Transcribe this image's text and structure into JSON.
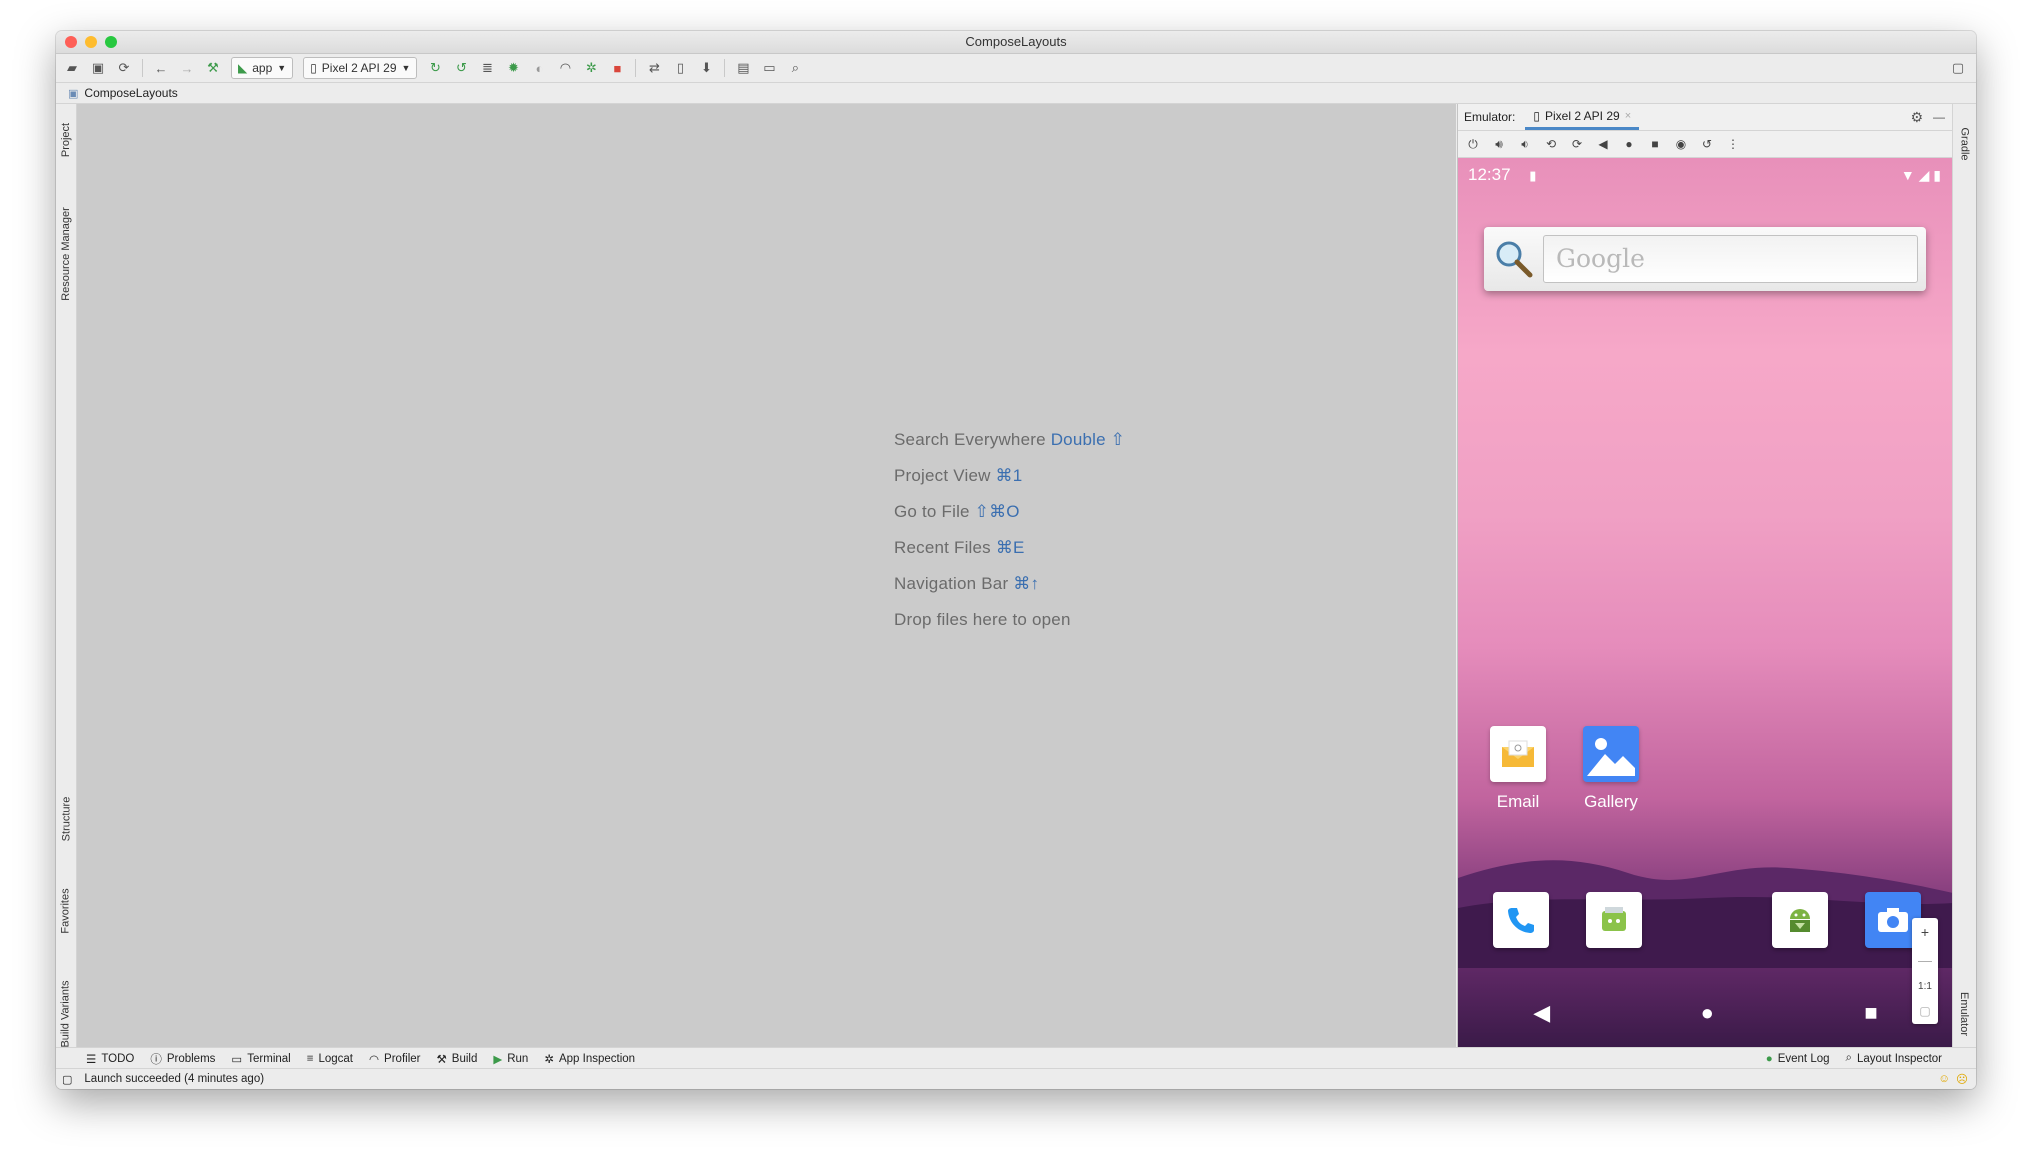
{
  "window": {
    "title": "ComposeLayouts"
  },
  "toolbar": {
    "run_config": "app",
    "device": "Pixel 2 API 29"
  },
  "breadcrumb": {
    "project": "ComposeLayouts"
  },
  "left_tabs": {
    "project": "Project",
    "resource_manager": "Resource Manager",
    "structure": "Structure",
    "favorites": "Favorites",
    "build_variants": "Build Variants"
  },
  "editor_hints": [
    {
      "label": "Search Everywhere",
      "shortcut": "Double ⇧"
    },
    {
      "label": "Project View",
      "shortcut": "⌘1"
    },
    {
      "label": "Go to File",
      "shortcut": "⇧⌘O"
    },
    {
      "label": "Recent Files",
      "shortcut": "⌘E"
    },
    {
      "label": "Navigation Bar",
      "shortcut": "⌘↑"
    },
    {
      "label": "Drop files here to open",
      "shortcut": ""
    }
  ],
  "emulator": {
    "label": "Emulator:",
    "tab": "Pixel 2 API 29",
    "phone": {
      "time": "12:37",
      "search_placeholder": "Google",
      "apps": {
        "email": "Email",
        "gallery": "Gallery"
      },
      "zoom_reset": "1:1"
    }
  },
  "right_tabs": {
    "gradle": "Gradle",
    "emulator": "Emulator"
  },
  "bottom_tools": {
    "todo": "TODO",
    "problems": "Problems",
    "terminal": "Terminal",
    "logcat": "Logcat",
    "profiler": "Profiler",
    "build": "Build",
    "run": "Run",
    "app_inspection": "App Inspection",
    "event_log": "Event Log",
    "layout_inspector": "Layout Inspector"
  },
  "status": {
    "message": "Launch succeeded (4 minutes ago)"
  },
  "colors": {
    "accent": "#3b6fb0",
    "traffic_red": "#fe5f57",
    "traffic_yellow": "#febc2e",
    "traffic_green": "#28c840"
  }
}
